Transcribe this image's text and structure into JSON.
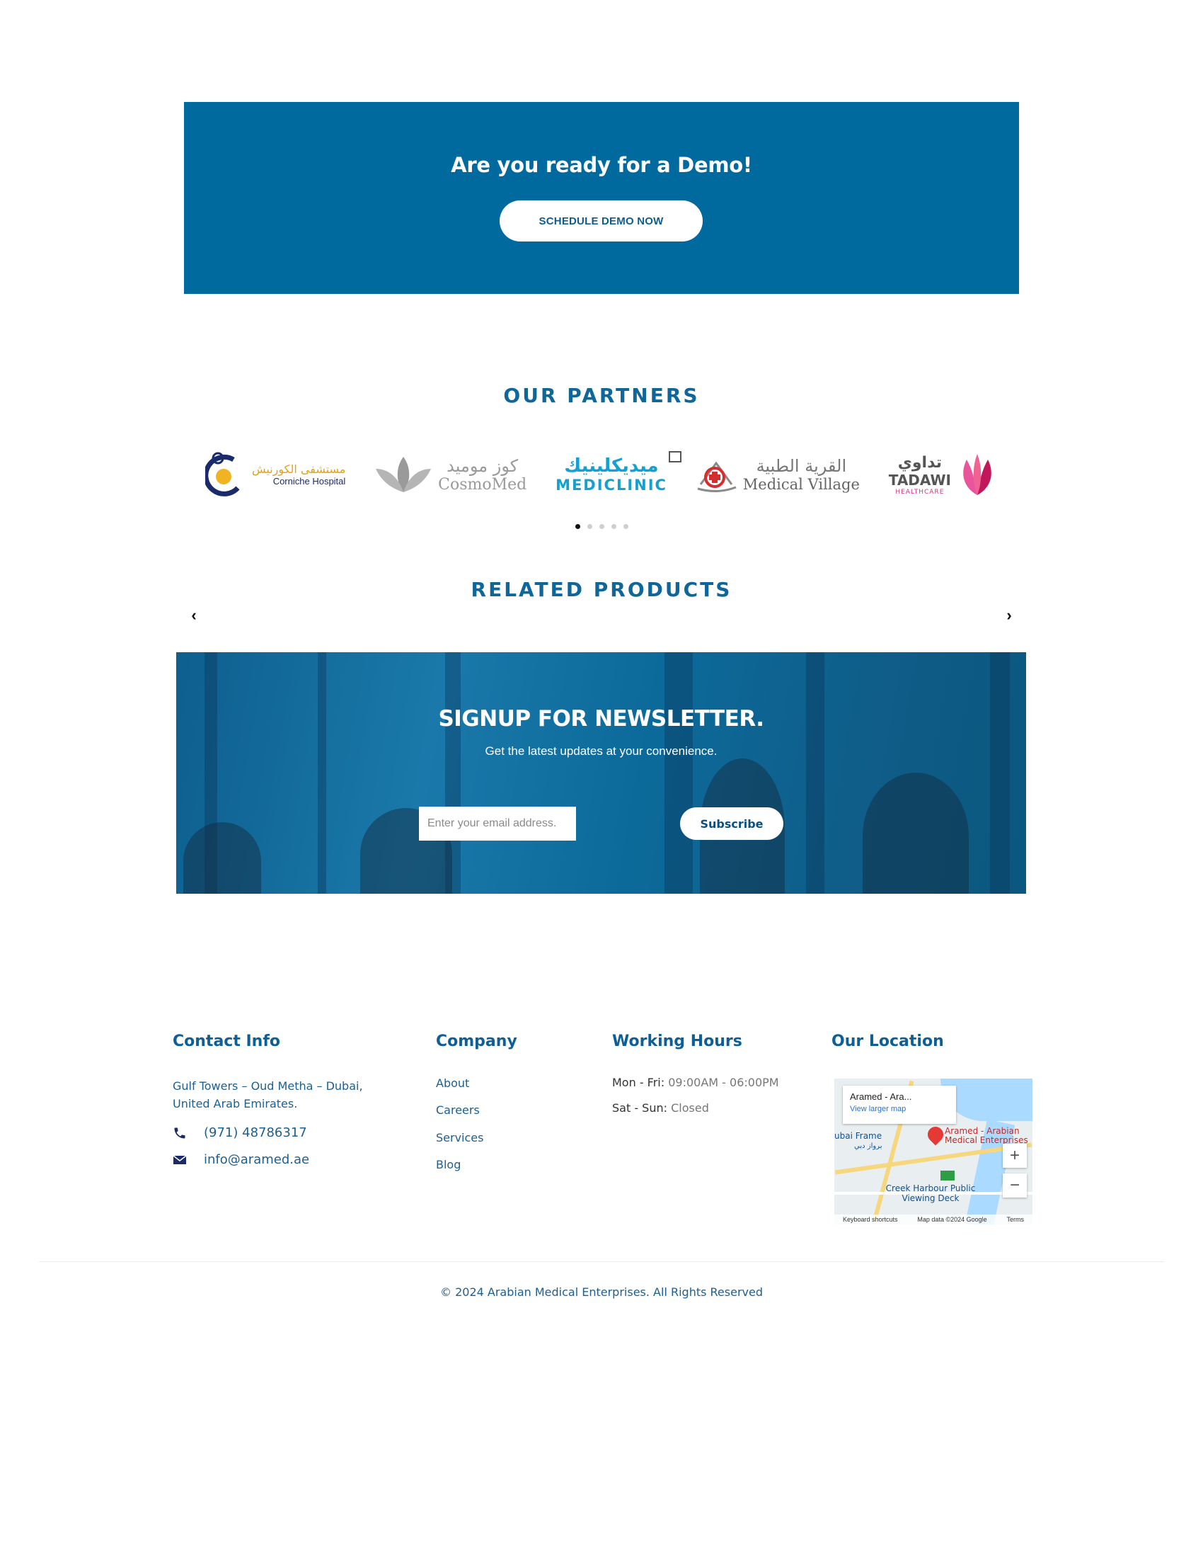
{
  "demo": {
    "title": "Are you ready for a Demo!",
    "button_label": "SCHEDULE DEMO NOW",
    "bg_color": "#006a9f"
  },
  "partners": {
    "title": "OUR PARTNERS",
    "logos": [
      {
        "name_ar": "مستشفى الكورنيش",
        "name_en": "Corniche Hospital",
        "icon": "corniche-hospital-logo"
      },
      {
        "name_ar": "كوز موميد",
        "name_en": "CosmoMed",
        "icon": "cosmomed-logo"
      },
      {
        "name_ar": "ميديكلينيك",
        "name_en": "MEDICLINIC",
        "icon": "mediclinic-logo"
      },
      {
        "name_ar": "القرية الطبية",
        "name_en": "Medical Village",
        "icon": "medical-village-logo"
      },
      {
        "name_ar": "تداوي",
        "name_en": "TADAWI",
        "name_sub": "HEALTHCARE",
        "icon": "tadawi-logo"
      }
    ],
    "slide_dots": 5,
    "active_dot": 0
  },
  "related": {
    "title": "RELATED PRODUCTS",
    "prev_icon": "chevron-left-icon",
    "next_icon": "chevron-right-icon"
  },
  "newsletter": {
    "title": "SIGNUP FOR NEWSLETTER.",
    "subtitle": "Get the latest updates at your convenience.",
    "email_placeholder": "Enter your email address.",
    "button_label": "Subscribe"
  },
  "footer": {
    "contact": {
      "title": "Contact Info",
      "address": "Gulf Towers – Oud Metha – Dubai, United Arab Emirates.",
      "phone": "(971) 48786317",
      "email": "info@aramed.ae"
    },
    "company": {
      "title": "Company",
      "links": [
        "About",
        "Careers",
        "Services",
        "Blog"
      ]
    },
    "hours": {
      "title": "Working Hours",
      "rows": [
        {
          "label": "Mon - Fri:",
          "value": "09:00AM - 06:00PM"
        },
        {
          "label": "Sat - Sun:",
          "value": "Closed"
        }
      ]
    },
    "location": {
      "title": "Our Location",
      "map_card_title": "Aramed - Ara...",
      "map_card_link": "View larger map",
      "pin_label": "Aramed - Arabian Medical Enterprises",
      "label_frame": "ubai Frame",
      "label_frame_ar": "برواز دبي",
      "label_creek": "Creek Harbour Public Viewing Deck",
      "zoom_in": "+",
      "zoom_out": "−",
      "footer_shortcuts": "Keyboard shortcuts",
      "footer_data": "Map data ©2024 Google",
      "footer_terms": "Terms"
    },
    "copyright": "© 2024 Arabian Medical Enterprises. All Rights Reserved"
  }
}
